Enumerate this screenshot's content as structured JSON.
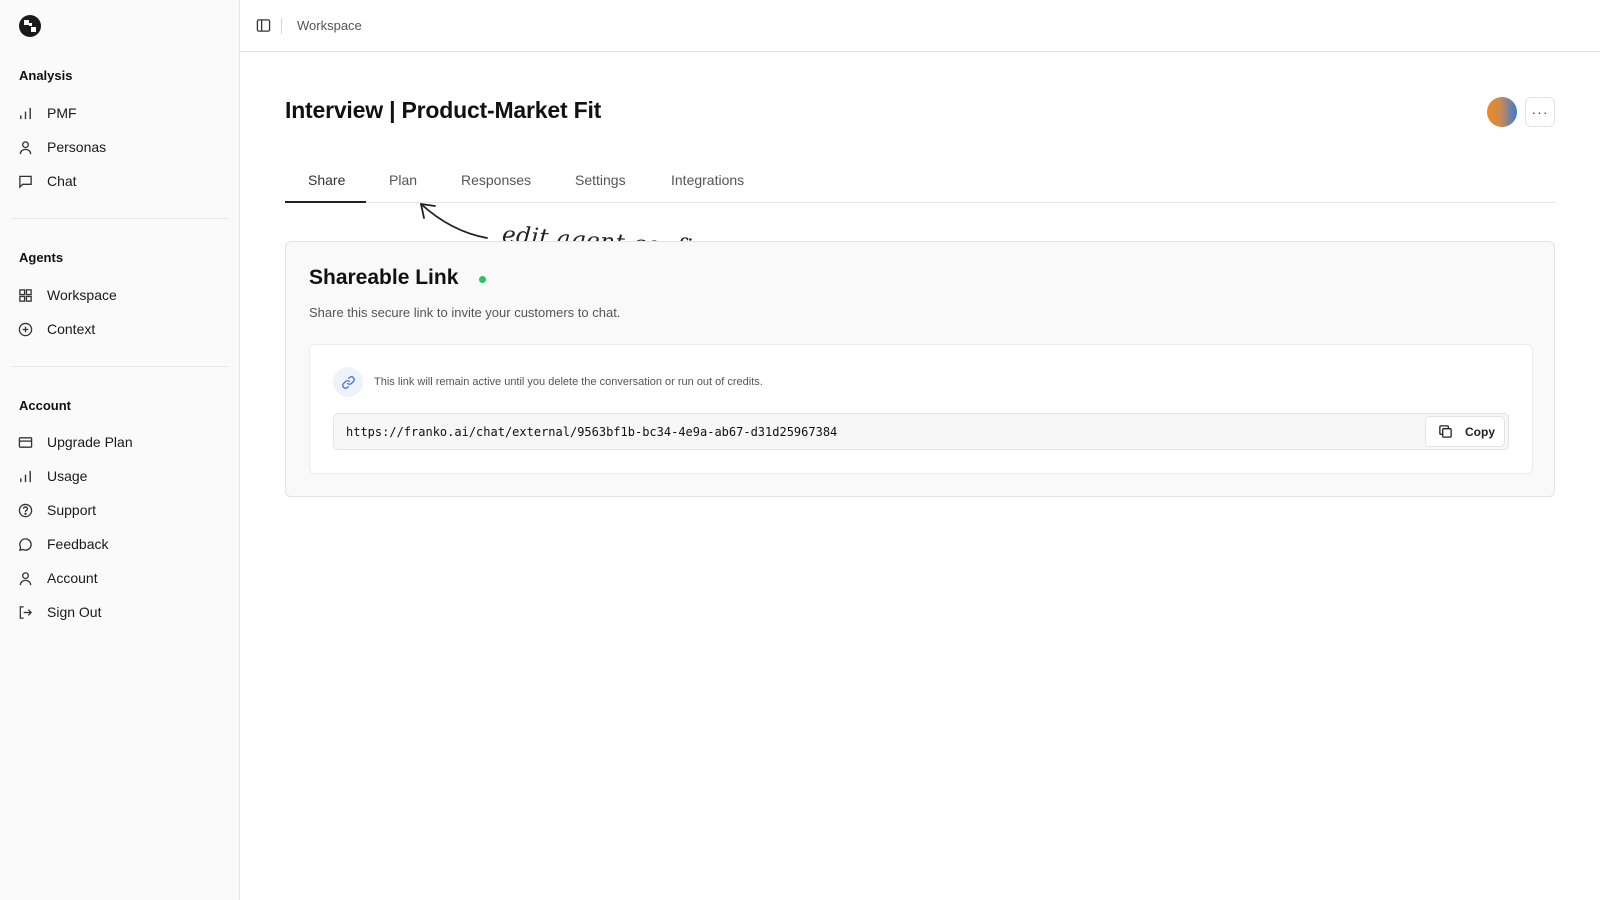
{
  "sidebar": {
    "sections": [
      {
        "title": "Analysis",
        "items": [
          {
            "label": "PMF",
            "icon": "bar-chart-icon"
          },
          {
            "label": "Personas",
            "icon": "user-icon"
          },
          {
            "label": "Chat",
            "icon": "message-square-icon"
          }
        ]
      },
      {
        "title": "Agents",
        "items": [
          {
            "label": "Workspace",
            "icon": "grid-icon"
          },
          {
            "label": "Context",
            "icon": "plus-circle-icon"
          }
        ]
      },
      {
        "title": "Account",
        "items": [
          {
            "label": "Upgrade Plan",
            "icon": "credit-card-icon"
          },
          {
            "label": "Usage",
            "icon": "bar-chart-icon"
          },
          {
            "label": "Support",
            "icon": "help-circle-icon"
          },
          {
            "label": "Feedback",
            "icon": "message-circle-icon"
          },
          {
            "label": "Account",
            "icon": "user-icon"
          },
          {
            "label": "Sign Out",
            "icon": "log-out-icon"
          }
        ]
      }
    ]
  },
  "topbar": {
    "breadcrumb": "Workspace"
  },
  "page": {
    "title": "Interview | Product-Market Fit"
  },
  "tabs": [
    {
      "label": "Share",
      "active": true
    },
    {
      "label": "Plan",
      "active": false
    },
    {
      "label": "Responses",
      "active": false
    },
    {
      "label": "Settings",
      "active": false
    },
    {
      "label": "Integrations",
      "active": false
    }
  ],
  "annotation": {
    "text": "edit agent configuration here..."
  },
  "share_card": {
    "title": "Shareable Link",
    "subtitle": "Share this secure link to invite your customers to chat.",
    "notice": "This link will remain active until you delete the conversation or run out of credits.",
    "url": "https://franko.ai/chat/external/9563bf1b-bc34-4e9a-ab67-d31d25967384",
    "copy_label": "Copy",
    "status_color": "#22c55e"
  },
  "colors": {
    "accent": "#22c55e",
    "sidebar_bg": "#fafafa",
    "border": "#e5e5e5"
  }
}
